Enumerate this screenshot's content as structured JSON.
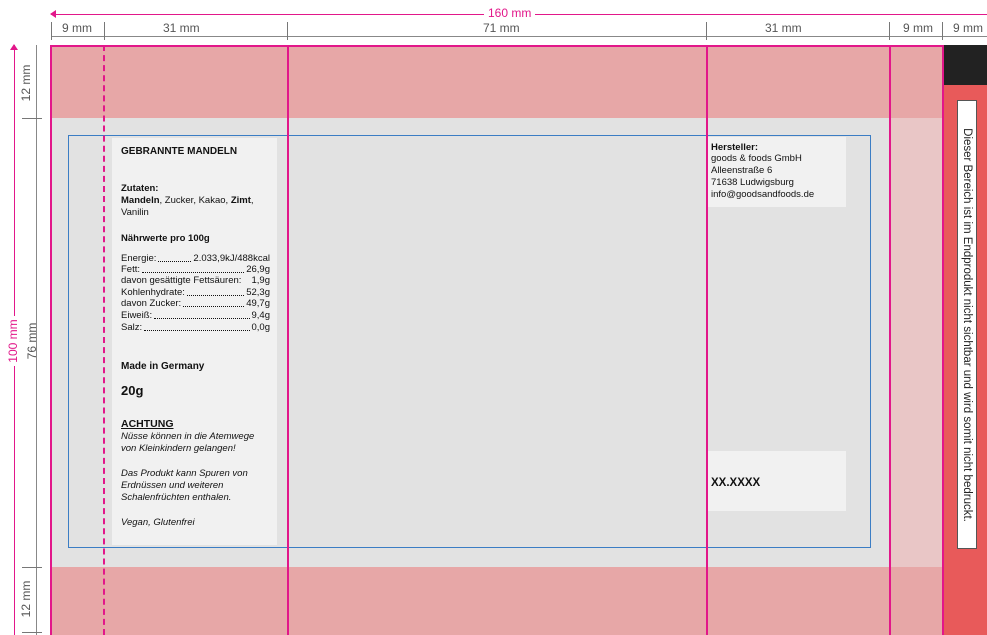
{
  "dimensions": {
    "total_width": "160 mm",
    "seg_left_margin": "9 mm",
    "seg_left_panel": "31 mm",
    "seg_center": "71 mm",
    "seg_right_panel": "31 mm",
    "seg_right_margin": "9 mm",
    "seg_right_strip": "9 mm",
    "height_top": "12 mm",
    "height_total": "100 mm",
    "height_middle": "76 mm",
    "height_bottom": "12 mm"
  },
  "ingredients": {
    "product_title": "GEBRANNTE MANDELN",
    "heading": "Zutaten:",
    "line1_bold_a": "Mandeln",
    "line1_text_a": ", Zucker, Kakao, ",
    "line1_bold_b": "Zimt",
    "line1_text_b": ",",
    "line2": "Vanilin"
  },
  "nutrition": {
    "heading": "Nährwerte pro 100g",
    "rows": [
      {
        "label": "Energie:",
        "value": "2.033,9kJ/488kcal"
      },
      {
        "label": "Fett:",
        "value": "26,9g"
      },
      {
        "label": "davon gesättigte Fettsäuren:",
        "value": "1,9g"
      },
      {
        "label": "Kohlenhydrate:",
        "value": "52,3g"
      },
      {
        "label": "davon Zucker:",
        "value": "49,7g"
      },
      {
        "label": "Eiweiß:",
        "value": "9,4g"
      },
      {
        "label": "Salz:",
        "value": "0,0g"
      }
    ]
  },
  "origin": "Made in Germany",
  "weight": "20g",
  "warning": {
    "heading": "ACHTUNG",
    "line1": "Nüsse können in die Atemwege",
    "line2": "von Kleinkindern gelangen!",
    "line3": "Das Produkt kann Spuren von",
    "line4": "Erdnüssen und weiteren",
    "line5": "Schalenfrüchten enthalen.",
    "line6": "Vegan, Glutenfrei"
  },
  "manufacturer": {
    "heading": "Hersteller:",
    "company": "goods & foods GmbH",
    "street": "Alleenstraße 6",
    "city": "71638 Ludwigsburg",
    "email": "info@goodsandfoods.de"
  },
  "lot_number": "XX.XXXX",
  "side_note": "Dieser Bereich ist im Endprodukt nicht sichtbar und wird somit nicht bedruckt.",
  "colors": {
    "bleed": "#e7a7a7",
    "safe_area": "#e2e2e2",
    "guide_magenta": "#e2178a",
    "safe_outline_blue": "#3b7dc4",
    "side_strip_red": "#e85a5a"
  }
}
